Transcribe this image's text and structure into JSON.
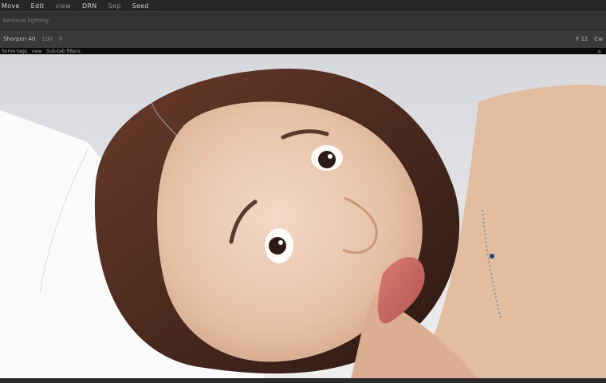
{
  "menubar": {
    "items": [
      {
        "label": "Move",
        "dim": false
      },
      {
        "label": "Edit",
        "dim": false
      },
      {
        "label": "view",
        "dim": true
      },
      {
        "label": "DRN",
        "dim": false
      },
      {
        "label": "Sep",
        "dim": true
      },
      {
        "label": "Seed",
        "dim": false
      }
    ]
  },
  "options_bar": {
    "field_text": "Remove lighting"
  },
  "toolbar": {
    "left_label": "Sharpen 40",
    "left_value": "100",
    "mid_1": "⚲",
    "mid_2": "·",
    "right_1": "F 12",
    "right_2": "Cw"
  },
  "doc_tabs": {
    "tabs": [
      "Some tags",
      "new",
      "Sub-tab filters"
    ],
    "right_icon": "≡"
  },
  "canvas": {
    "image_description": "portrait photo"
  },
  "colors": {
    "menubar_bg": "#262626",
    "toolbar_bg": "#3a3a3a",
    "canvas_bg": "#e1e2e6",
    "skin": "#e9c7ad",
    "hair": "#4a2a1f"
  }
}
